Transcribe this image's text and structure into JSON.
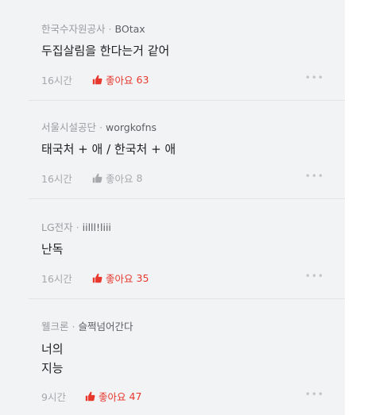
{
  "comments": [
    {
      "company": "한국수자원공사",
      "author": "BOtax",
      "lines": [
        "두집살림을 한다는거 같어"
      ],
      "time": "16시간",
      "like_label": "좋아요",
      "like_count": "63",
      "liked_color": "#e8372c"
    },
    {
      "company": "서울시설공단",
      "author": "worgkofns",
      "lines": [
        "태국처 + 애 / 한국처 + 애"
      ],
      "time": "16시간",
      "like_label": "좋아요",
      "like_count": "8",
      "liked_color": "#a6a8ac"
    },
    {
      "company": "LG전자",
      "author": "iilll!liii",
      "lines": [
        "난독"
      ],
      "time": "16시간",
      "like_label": "좋아요",
      "like_count": "35",
      "liked_color": "#e8372c"
    },
    {
      "company": "웰크론",
      "author": "슬쩍넘어간다",
      "lines": [
        "너의",
        "지능"
      ],
      "time": "9시간",
      "like_label": "좋아요",
      "like_count": "47",
      "liked_color": "#e8372c"
    }
  ],
  "separator": "·",
  "more_icon": "more-horizontal-icon"
}
